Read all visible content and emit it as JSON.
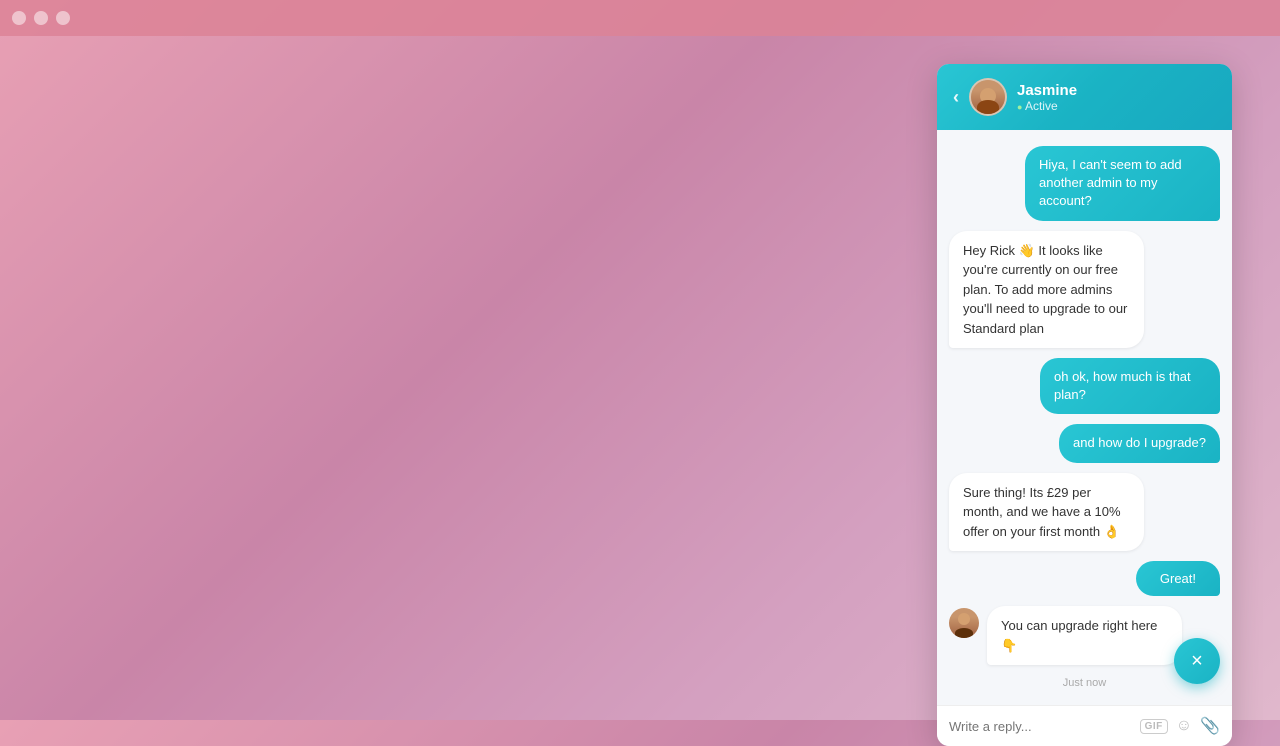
{
  "titlebar": {
    "dots": [
      "dot1",
      "dot2",
      "dot3"
    ]
  },
  "chat": {
    "header": {
      "back_icon": "‹",
      "name": "Jasmine",
      "status": "Active"
    },
    "messages": [
      {
        "id": "msg1",
        "type": "user",
        "text": "Hiya, I can't seem to add another admin to my account?"
      },
      {
        "id": "msg2",
        "type": "agent",
        "text": "Hey Rick 👋 It looks like you're currently on our free plan. To add more admins you'll need to upgrade to our Standard plan"
      },
      {
        "id": "msg3",
        "type": "user",
        "text": "oh ok, how much is that plan?"
      },
      {
        "id": "msg4",
        "type": "user",
        "text": "and how do I upgrade?"
      },
      {
        "id": "msg5",
        "type": "agent",
        "text": "Sure thing! Its £29 per month, and we have a 10% offer on your first month 👌"
      },
      {
        "id": "msg6",
        "type": "user_action",
        "text": "Great!"
      },
      {
        "id": "msg7",
        "type": "agent_with_avatar",
        "text": "You can upgrade right here 👇",
        "timestamp": "Just now"
      }
    ],
    "input": {
      "placeholder": "Write a reply..."
    }
  },
  "fab": {
    "icon": "×"
  }
}
